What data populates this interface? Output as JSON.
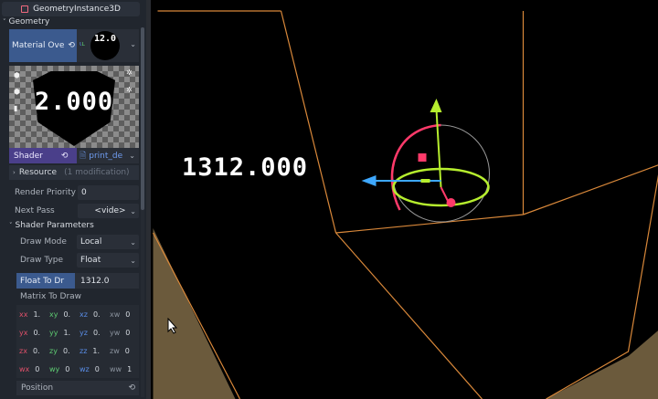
{
  "inspector": {
    "node_title": "GeometryInstance3D",
    "section": "Geometry",
    "material_override_label": "Material Ove",
    "material_thumb_text": "12.0",
    "preview_text": "2.000",
    "shader_label": "Shader",
    "shader_value": "print_de",
    "resource_label": "Resource",
    "resource_modification": "(1 modification)",
    "render_priority_label": "Render Priority",
    "render_priority_value": "0",
    "next_pass_label": "Next Pass",
    "next_pass_value": "<vide>",
    "shader_params_label": "Shader Parameters",
    "draw_mode_label": "Draw Mode",
    "draw_mode_value": "Local",
    "draw_type_label": "Draw Type",
    "draw_type_value": "Float",
    "float_to_draw_label": "Float To Dr",
    "float_to_draw_value": "1312.0",
    "matrix_label": "Matrix To Draw",
    "matrix": [
      [
        {
          "k": "xx",
          "v": "1."
        },
        {
          "k": "xy",
          "v": "0."
        },
        {
          "k": "xz",
          "v": "0."
        },
        {
          "k": "xw",
          "v": "0"
        }
      ],
      [
        {
          "k": "yx",
          "v": "0."
        },
        {
          "k": "yy",
          "v": "1."
        },
        {
          "k": "yz",
          "v": "0."
        },
        {
          "k": "yw",
          "v": "0"
        }
      ],
      [
        {
          "k": "zx",
          "v": "0."
        },
        {
          "k": "zy",
          "v": "0."
        },
        {
          "k": "zz",
          "v": "1."
        },
        {
          "k": "zw",
          "v": "0"
        }
      ],
      [
        {
          "k": "wx",
          "v": "0"
        },
        {
          "k": "wy",
          "v": "0"
        },
        {
          "k": "wz",
          "v": "0"
        },
        {
          "k": "ww",
          "v": "1"
        }
      ]
    ],
    "position_label": "Position"
  },
  "viewport": {
    "displayed_value": "1312.000"
  },
  "colors": {
    "material_row_bg": "#3b5a8e",
    "shader_row_bg": "#4a3f8a",
    "box_edge": "#d9883a",
    "gizmo_red": "#ff3a6a",
    "gizmo_green": "#b6ee2e",
    "gizmo_blue": "#3ea8ff",
    "ground": "#6b5a3c"
  }
}
